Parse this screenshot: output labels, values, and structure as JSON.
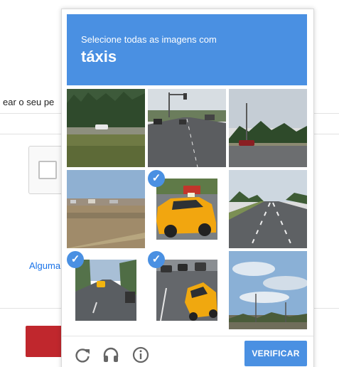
{
  "background": {
    "partial_text": "ear o seu pe",
    "link_text": "Alguma",
    "accent_red": "#c0272d"
  },
  "captcha": {
    "instruction": "Selecione todas as imagens com",
    "target": "táxis",
    "header_color": "#4a90e2",
    "tiles": [
      {
        "id": 1,
        "scene": "grassy-field-with-car",
        "selected": false
      },
      {
        "id": 2,
        "scene": "city-road-intersection",
        "selected": false
      },
      {
        "id": 3,
        "scene": "road-junction-trees",
        "selected": false
      },
      {
        "id": 4,
        "scene": "dry-field-and-town",
        "selected": false
      },
      {
        "id": 5,
        "scene": "yellow-taxi-close",
        "selected": true
      },
      {
        "id": 6,
        "scene": "empty-highway",
        "selected": false
      },
      {
        "id": 7,
        "scene": "street-with-taxi",
        "selected": true
      },
      {
        "id": 8,
        "scene": "taxi-in-traffic",
        "selected": true
      },
      {
        "id": 9,
        "scene": "sky-and-street-lights",
        "selected": false
      }
    ],
    "check_mark": "✓",
    "footer": {
      "reload_icon": "reload-icon",
      "audio_icon": "headphones-icon",
      "info_icon": "info-icon",
      "verify_label": "VERIFICAR"
    }
  }
}
